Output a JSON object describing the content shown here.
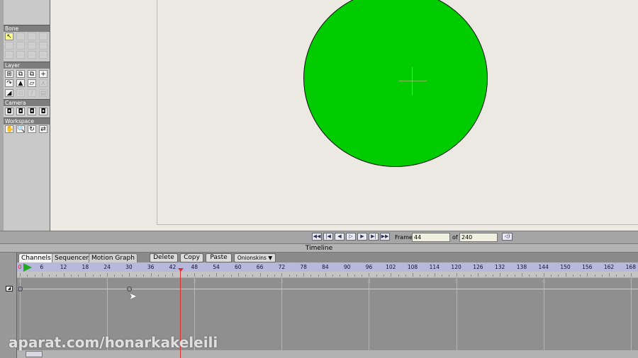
{
  "toolbar": {
    "sections": [
      "Bone",
      "Layer",
      "Camera",
      "Workspace"
    ]
  },
  "playback": {
    "frame_label": "Frame",
    "frame_value": "44",
    "of_label": "of",
    "total_frames": "240"
  },
  "timeline": {
    "title": "Timeline",
    "tabs": [
      "Channels",
      "Sequencer",
      "Motion Graph"
    ],
    "active_tab": "Channels",
    "buttons": {
      "delete": "Delete",
      "copy": "Copy",
      "paste": "Paste",
      "onionskins": "Onionskins ▼"
    },
    "ruler_labels": [
      "0",
      "6",
      "12",
      "18",
      "24",
      "30",
      "36",
      "42",
      "48",
      "54",
      "60",
      "66",
      "72",
      "78",
      "84",
      "90",
      "96",
      "102",
      "108",
      "114",
      "120",
      "126",
      "132",
      "138",
      "144",
      "150",
      "156",
      "162",
      "168"
    ],
    "second_labels": [
      "0",
      "1",
      "2",
      "3",
      "4",
      "5",
      "6",
      "7"
    ],
    "current_frame": 44,
    "keyframes": [
      0,
      30
    ]
  },
  "watermark": "aparat.com/honarkakeleili",
  "colors": {
    "shape_fill": "#00cc00",
    "playhead": "#e03030",
    "canvas": "#ebe9e2"
  }
}
